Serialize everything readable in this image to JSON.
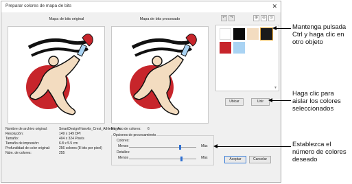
{
  "dialog": {
    "title": "Preparar colores de mapa de bits",
    "close_glyph": "✕",
    "original_caption": "Mapa de bits original",
    "processed_caption": "Mapa de bits procesado",
    "toolbar": {
      "undo_icon": "undo-icon",
      "redo_icon": "redo-icon",
      "zoom_in_icon": "zoom-in-icon",
      "zoom_out_icon": "zoom-out-icon",
      "zoom_fit_icon": "zoom-fit-icon"
    },
    "swatches": [
      "#ffffff",
      "#0a0a0a",
      "#f3dcc0",
      "#1b1b1b",
      "#c7252b",
      "#a9d3f3"
    ],
    "buttons": {
      "ubicar": "Ubicar",
      "unir": "Unir",
      "accept": "Aceptar",
      "cancel": "Cancelar"
    },
    "info": {
      "file_label": "Nombre de archivo original:",
      "file_value": "SmartDesign\\Hanvils_Crest_Athletes_Ac",
      "resolution_label": "Resolución:",
      "resolution_value": "149 x 149 DPI",
      "size_label": "Tamaño:",
      "size_value": "404 x 324 Pixels",
      "print_label": "Tamaño de impresión:",
      "print_value": "6.8 x 5.5 cm",
      "depth_label": "Profundidad de color original:",
      "depth_value": "256 colores (8 bits por pixel)",
      "colors_label": "Núm. de colores:",
      "colors_value": "255"
    },
    "processing": {
      "num_colors_label": "Número de colores:",
      "num_colors_value": "6",
      "options_title": "Opciones de procesamiento",
      "colors_label": "Colores:",
      "details_label": "Detalles:",
      "less": "Menos",
      "more": "Más",
      "colors_slider_value": 0.75,
      "details_slider_value": 0.78
    }
  },
  "callouts": {
    "hold": "Mantenga pulsada Ctrl y haga clic en otro objeto",
    "isolate": "Haga clic para aislar los colores seleccionados",
    "set": "Establezca el número de colores deseado"
  }
}
